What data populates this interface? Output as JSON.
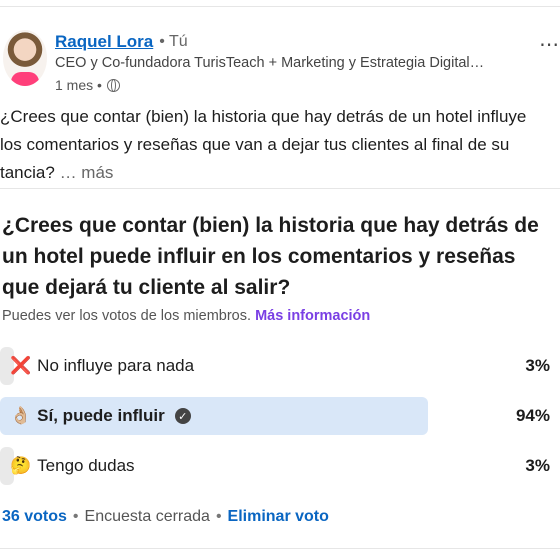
{
  "author": {
    "name": "Raquel Lora",
    "you_label": "• Tú",
    "headline": "CEO y Co-fundadora TurisTeach + Marketing y Estrategia Digital…",
    "time": "1 mes •"
  },
  "post": {
    "line1": "¿Crees que contar (bien) la historia que hay detrás de un hotel influye",
    "line2": " los comentarios y reseñas que van a dejar tus clientes al final de su",
    "line3": "tancia?",
    "more": "… más"
  },
  "poll": {
    "question": "¿Crees que contar (bien) la historia que hay detrás de un hotel puede influir en los comentarios y reseñas que dejará tu cliente al salir?",
    "note": "Puedes ver los votos de los miembros.",
    "note_link": "Más información",
    "options": [
      {
        "emoji": "❌",
        "label": "No influye para nada",
        "percent": "3%",
        "fraction": 0.03,
        "icon": "cross-mark-icon"
      },
      {
        "emoji": "👌🏼",
        "label": "Sí, puede influir",
        "percent": "94%",
        "fraction": 0.94,
        "icon": "ok-hand-icon",
        "selected": true
      },
      {
        "emoji": "🤔",
        "label": "Tengo dudas",
        "percent": "3%",
        "fraction": 0.03,
        "icon": "thinking-face-icon"
      }
    ],
    "votes": "36 votos",
    "status": "Encuesta cerrada",
    "remove_vote": "Eliminar voto"
  },
  "colors": {
    "link_blue": "#0a66c2",
    "purple_link": "#7a3fe4",
    "selected_fill": "#d9e7f8",
    "unselected_fill": "#e9e9e9"
  }
}
